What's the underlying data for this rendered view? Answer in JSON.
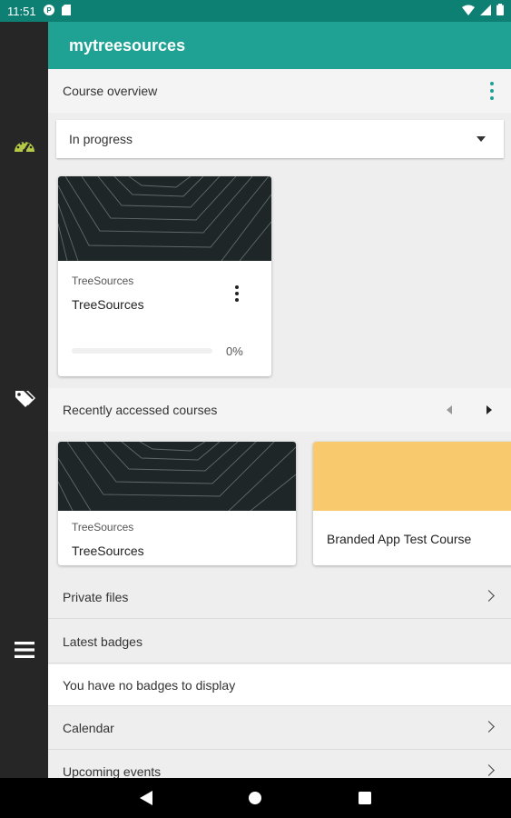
{
  "status_bar": {
    "time": "11:51"
  },
  "app": {
    "title": "mytreesources",
    "accent": "#1fa293",
    "status_color": "#0d7f73"
  },
  "rail": {
    "items": [
      {
        "icon": "dashboard-icon"
      },
      {
        "icon": "tags-icon"
      },
      {
        "icon": "menu-icon"
      }
    ]
  },
  "course_overview": {
    "title": "Course overview",
    "filter": "In progress",
    "courses": [
      {
        "category": "TreeSources",
        "name": "TreeSources",
        "progress": 0,
        "progress_label": "0%"
      }
    ]
  },
  "recent": {
    "title": "Recently accessed courses",
    "courses": [
      {
        "category": "TreeSources",
        "name": "TreeSources"
      },
      {
        "name": "Branded App Test Course",
        "image_color": "#f9c96e"
      }
    ]
  },
  "rows": {
    "private_files": "Private files",
    "latest_badges": "Latest badges",
    "no_badges": "You have no badges to display",
    "calendar": "Calendar",
    "upcoming_events": "Upcoming events"
  }
}
